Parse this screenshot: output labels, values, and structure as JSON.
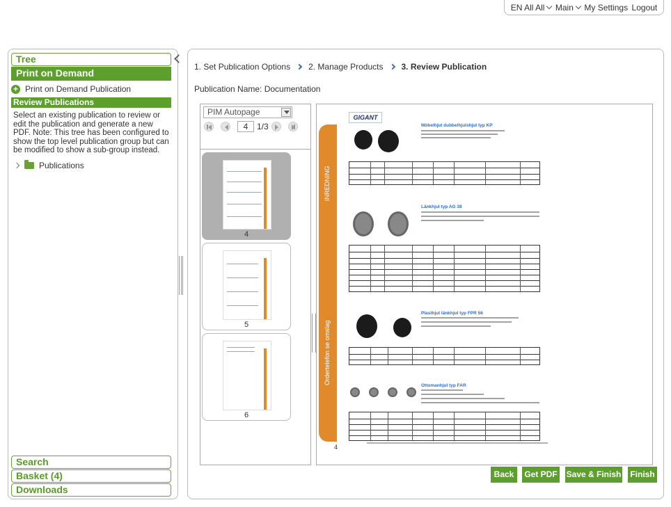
{
  "topbar": {
    "language": "EN All All",
    "main": "Main",
    "settings": "My Settings",
    "logout": "Logout"
  },
  "sidebar": {
    "tree_label": "Tree",
    "active_label": "Print on Demand",
    "pod_item": "Print on Demand Publication",
    "section_title": "Review Publications",
    "description": "Select an existing publication to review or edit the publication and generate a new PDF. Note: This tree has been configured to show the top level publication group but can be modified to show a sub-group instead.",
    "tree_node": "Publications",
    "bottom": [
      "Search",
      "Basket (4)",
      "Downloads"
    ]
  },
  "steps": [
    "1. Set Publication Options",
    "2. Manage Products",
    "3. Review Publication"
  ],
  "publication": {
    "label": "Publication Name: Documentation"
  },
  "viewer": {
    "select_value": "PIM Autopage",
    "page_input": "4",
    "page_total": "1/3",
    "thumbs": [
      {
        "num": "4"
      },
      {
        "num": "5"
      },
      {
        "num": "6"
      }
    ]
  },
  "preview": {
    "brand": "GIGANT",
    "side_top": "INREDNING",
    "side_bottom": "Ordertelefon se omslag",
    "page_number": "4",
    "products": [
      "Möbelhjul dubbelhjulshjul typ KP",
      "Länkhjul typ AG 38",
      "Plasthjul länkhjul typ FPR 56",
      "Ottomanhjul typ FAR"
    ]
  },
  "buttons": {
    "back": "Back",
    "pdf": "Get PDF",
    "save": "Save & Finish",
    "finish": "Finish"
  },
  "colors": {
    "accent": "#5d9f2c",
    "orange": "#e08a2c",
    "link": "#2a6ed0"
  }
}
